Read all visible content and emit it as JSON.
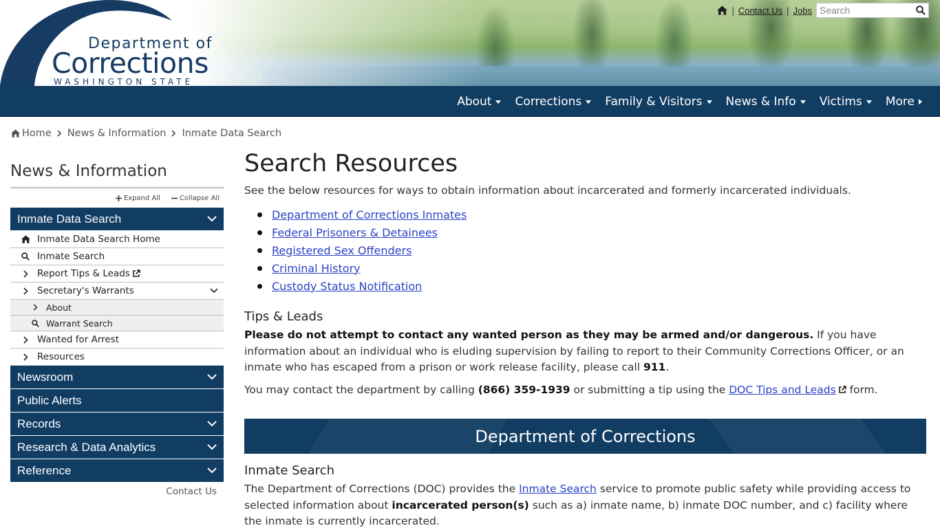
{
  "header": {
    "logo": {
      "line1": "Department of",
      "line2": "Corrections",
      "line3": "WASHINGTON STATE"
    },
    "utility": {
      "contact_label": "Contact Us",
      "jobs_label": "Jobs",
      "search_placeholder": "Search"
    }
  },
  "mainnav": {
    "items": [
      {
        "label": "About"
      },
      {
        "label": "Corrections"
      },
      {
        "label": "Family & Visitors"
      },
      {
        "label": "News & Info"
      },
      {
        "label": "Victims"
      },
      {
        "label": "More"
      }
    ]
  },
  "breadcrumb": {
    "items": [
      "Home",
      "News & Information",
      "Inmate Data Search"
    ]
  },
  "sidebar": {
    "title": "News & Information",
    "expand_all": "Expand All",
    "collapse_all": "Collapse All",
    "sections": [
      {
        "label": "Inmate Data Search"
      },
      {
        "label": "Newsroom"
      },
      {
        "label": "Public Alerts"
      },
      {
        "label": "Records"
      },
      {
        "label": "Research & Data Analytics"
      },
      {
        "label": "Reference"
      }
    ],
    "items": [
      {
        "label": "Inmate Data Search Home"
      },
      {
        "label": "Inmate Search"
      },
      {
        "label": "Report Tips & Leads"
      },
      {
        "label": "Secretary's Warrants"
      },
      {
        "label": "Wanted for Arrest"
      },
      {
        "label": "Resources"
      }
    ],
    "subitems": [
      {
        "label": "About"
      },
      {
        "label": "Warrant Search"
      }
    ],
    "contact": "Contact Us"
  },
  "main": {
    "title": "Search Resources",
    "intro": "See the below resources for ways to obtain information about incarcerated and formerly incarcerated individuals.",
    "links": [
      "Department of Corrections Inmates",
      "Federal Prisoners & Detainees",
      "Registered Sex Offenders",
      "Criminal History",
      "Custody Status Notification"
    ],
    "tips": {
      "heading": "Tips & Leads",
      "warning": "Please do not attempt to contact any wanted person as they may be armed and/or dangerous.",
      "text": " If you have information about an individual who is eluding supervision by failing to report to their Community Corrections Officer, or an inmate who has escaped from a prison or work release facility, please call ",
      "emergency": "911",
      "end": ".",
      "contact_pre": "You may contact the department by calling ",
      "phone": "(866) 359-1939",
      "contact_mid": " or submitting a tip using the ",
      "tips_link": "DOC Tips and Leads",
      "contact_post": " form."
    },
    "banner": "Department of Corrections",
    "inmate_search": {
      "heading": "Inmate Search",
      "pre": "The Department of Corrections (DOC) provides the ",
      "link": "Inmate Search",
      "mid": " service to promote public safety while providing access to selected information about ",
      "bold": "incarcerated person(s)",
      "post": " such as a) inmate name, b) inmate DOC number, and c) facility where the inmate is currently incarcerated."
    }
  }
}
